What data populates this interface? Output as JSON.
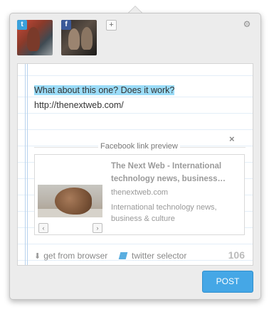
{
  "accounts": [
    {
      "network": "twitter",
      "badge": "t"
    },
    {
      "network": "facebook",
      "badge": "f"
    }
  ],
  "add_account_label": "+",
  "editor": {
    "highlighted_text": "What about this one? Does it work?",
    "rest_text": " http://thenextweb.com/"
  },
  "preview": {
    "section_label": "Facebook link preview",
    "close_symbol": "×",
    "title": "The Next Web - International technology news, business…",
    "domain": "thenextweb.com",
    "description": "International technology news, business & culture",
    "prev_symbol": "‹",
    "next_symbol": "›"
  },
  "footer": {
    "get_from_browser": "get from browser",
    "twitter_selector": "twitter selector",
    "char_count": "106"
  },
  "post_label": "POST",
  "colors": {
    "accent": "#45a7e6",
    "highlight": "#9bdcf8",
    "facebook": "#3b5998",
    "twitter": "#3aa1db"
  }
}
